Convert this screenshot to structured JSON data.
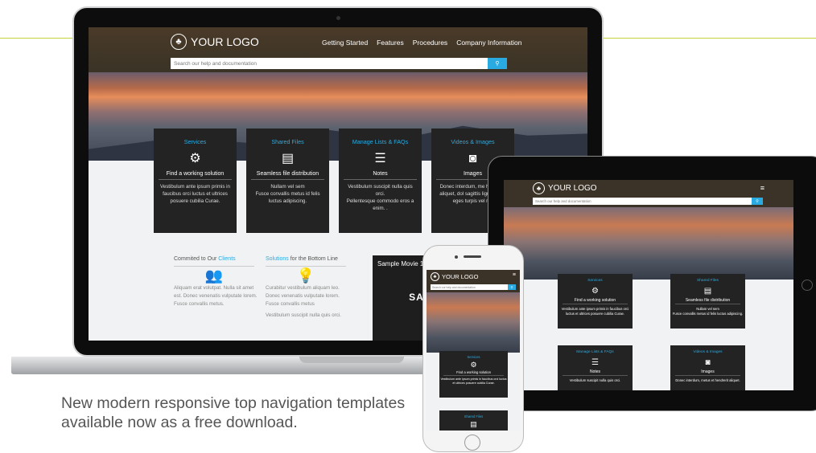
{
  "caption": "New modern responsive top navigation templates available now as a free download.",
  "brand": {
    "logo_text": "YOUR LOGO",
    "accent": "#29abe2",
    "deco_line": "#c6d23b"
  },
  "search": {
    "placeholder": "Search our help and documentation",
    "icon": "search-icon"
  },
  "nav": [
    "Getting Started",
    "Features",
    "Procedures",
    "Company Information"
  ],
  "menu_icon": "hamburger-icon",
  "cards": [
    {
      "title": "Services",
      "icon": "gear-icon",
      "glyph": "⚙",
      "subtitle": "Find a working solution",
      "text": [
        "Vestibulum ante ipsum primis in faucibus orci luctus et ultrices posuere cubilia Curae."
      ]
    },
    {
      "title": "Shared Files",
      "icon": "file-icon",
      "glyph": "▤",
      "subtitle": "Seamless file distribution",
      "text": [
        "Nullam vel sem",
        "Fusce convallis metus id felis luctus adipiscing."
      ]
    },
    {
      "title": "Manage Lists & FAQs",
      "icon": "faq-icon",
      "glyph": "☰",
      "subtitle": "Notes",
      "text": [
        "Vestibulum suscipit nulla quis orci.",
        "Pellentesque commodo eros a enim. ."
      ]
    },
    {
      "title": "Videos & Images",
      "icon": "camera-icon",
      "glyph": "◙",
      "subtitle": "Images",
      "text": [
        "Donec interdum, me hendrerit aliquet, dol sagittis ligula, eget eges turpis vel mi."
      ]
    }
  ],
  "lower": {
    "col1": {
      "title_prefix": "Commited to Our ",
      "title_link": "Clients",
      "icon": "users-icon",
      "text": "Aliquam erat volutpat. Nulla sit amet est. Donec venenatis vulputate lorem. Fusce convallis metus."
    },
    "col2": {
      "title_link": "Solutions",
      "title_suffix": " for the Bottom Line",
      "icon": "lightbulb-icon",
      "text": "Curabitur vestibulum aliquam leo. Donec venenatis vulputate lorem. Fusce convallis metus",
      "text2": "Vestibulum suscipit nulla quis orci."
    },
    "movie": {
      "title": "Sample Movie 1",
      "big": "SAM"
    }
  },
  "tablet": {
    "cards": [
      {
        "title": "Services",
        "glyph": "⚙",
        "subtitle": "Find a working solution",
        "text": "Vestibulum ante ipsum primis in faucibus orci luctus et ultrices posuere cubilia Curae."
      },
      {
        "title": "Shared Files",
        "glyph": "▤",
        "subtitle": "Seamless file distribution",
        "text": "Nullam vel sem",
        "text2": "Fusce convallis metus id felis luctus adipiscing."
      },
      {
        "title": "Manage Lists & FAQs",
        "glyph": "☰",
        "subtitle": "Notes",
        "text": "Vestibulum suscipit nulla quis orci."
      },
      {
        "title": "Videos & Images",
        "glyph": "◙",
        "subtitle": "Images",
        "text": "Donec interdum, metus et hendrerit aliquet."
      }
    ]
  },
  "phone": {
    "cards": [
      {
        "title": "Services",
        "glyph": "⚙",
        "subtitle": "Find a working solution",
        "text": "Vestibulum ante ipsum primis in faucibus orci luctus et ultrices posuere cubilia Curae."
      },
      {
        "title": "Shared Files",
        "glyph": "▤"
      }
    ]
  }
}
